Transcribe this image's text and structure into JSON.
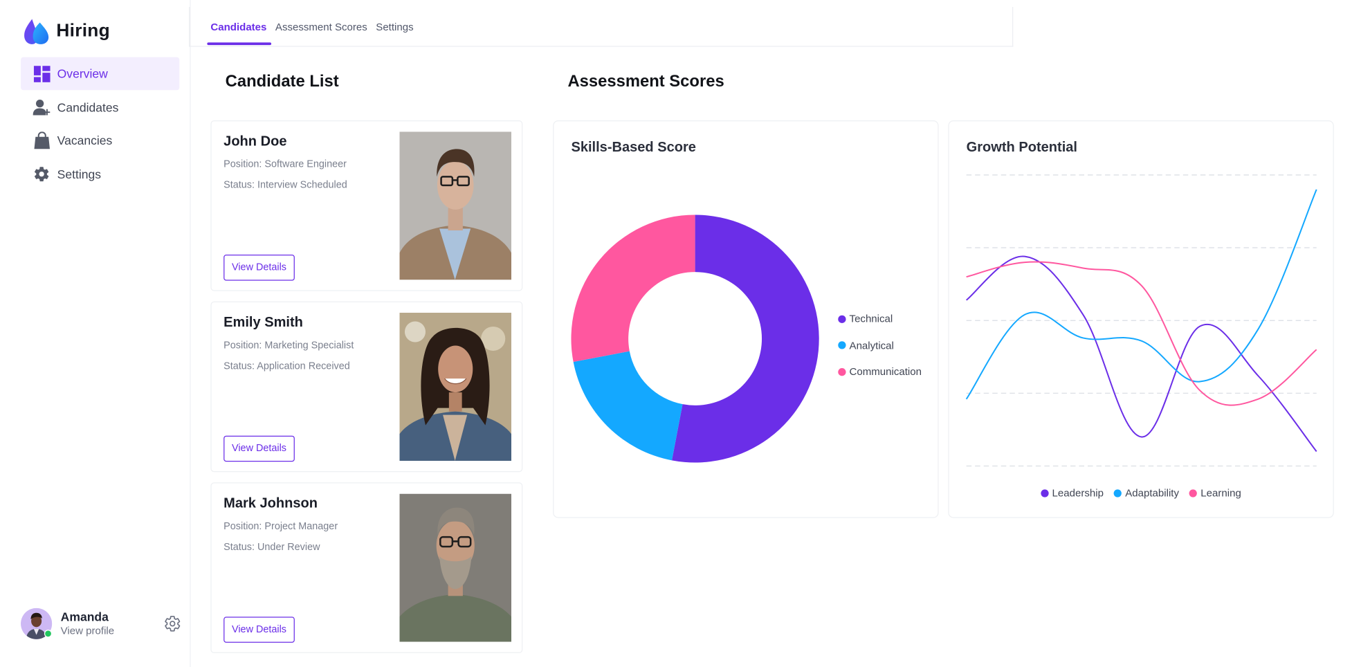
{
  "brand": {
    "title": "Hiring"
  },
  "nav": {
    "items": [
      {
        "label": "Overview",
        "icon": "dashboard-icon",
        "active": true
      },
      {
        "label": "Candidates",
        "icon": "add-user-icon",
        "active": false
      },
      {
        "label": "Vacancies",
        "icon": "shopping-bag-icon",
        "active": false
      },
      {
        "label": "Settings",
        "icon": "gear-icon",
        "active": false
      }
    ]
  },
  "profile": {
    "name": "Amanda",
    "link": "View profile"
  },
  "tabs": [
    {
      "label": "Candidates",
      "active": true
    },
    {
      "label": "Assessment Scores",
      "active": false
    },
    {
      "label": "Settings",
      "active": false
    }
  ],
  "sections": {
    "candidate_list": "Candidate List",
    "assessment_scores": "Assessment Scores"
  },
  "candidates": [
    {
      "name": "John Doe",
      "position": "Position: Software Engineer",
      "status": "Status: Interview Scheduled",
      "button": "View Details"
    },
    {
      "name": "Emily Smith",
      "position": "Position: Marketing Specialist",
      "status": "Status: Application Received",
      "button": "View Details"
    },
    {
      "name": "Mark Johnson",
      "position": "Position: Project Manager",
      "status": "Status: Under Review",
      "button": "View Details"
    }
  ],
  "colors": {
    "accent": "#6b2ee8",
    "blue": "#14a8ff",
    "pink": "#ff579f"
  },
  "chart_data": [
    {
      "type": "pie",
      "title": "Skills-Based Score",
      "donut": true,
      "labels": [
        "Technical",
        "Analytical",
        "Communication"
      ],
      "values": [
        53,
        19,
        28
      ],
      "colors": [
        "#6b2ee8",
        "#14a8ff",
        "#ff579f"
      ],
      "legend": "right"
    },
    {
      "type": "line",
      "title": "Growth Potential",
      "smooth": true,
      "grid": true,
      "legend": "bottom",
      "x": [
        1,
        2,
        3,
        4,
        5,
        6,
        7
      ],
      "ylim": [
        0,
        100
      ],
      "series": [
        {
          "name": "Leadership",
          "color": "#6b2ee8",
          "values": [
            57,
            72,
            52,
            10,
            48,
            31,
            5
          ]
        },
        {
          "name": "Adaptability",
          "color": "#14a8ff",
          "values": [
            23,
            52,
            44,
            43,
            29,
            47,
            95
          ]
        },
        {
          "name": "Learning",
          "color": "#ff579f",
          "values": [
            65,
            70,
            68,
            62,
            26,
            23,
            40
          ]
        }
      ]
    }
  ]
}
